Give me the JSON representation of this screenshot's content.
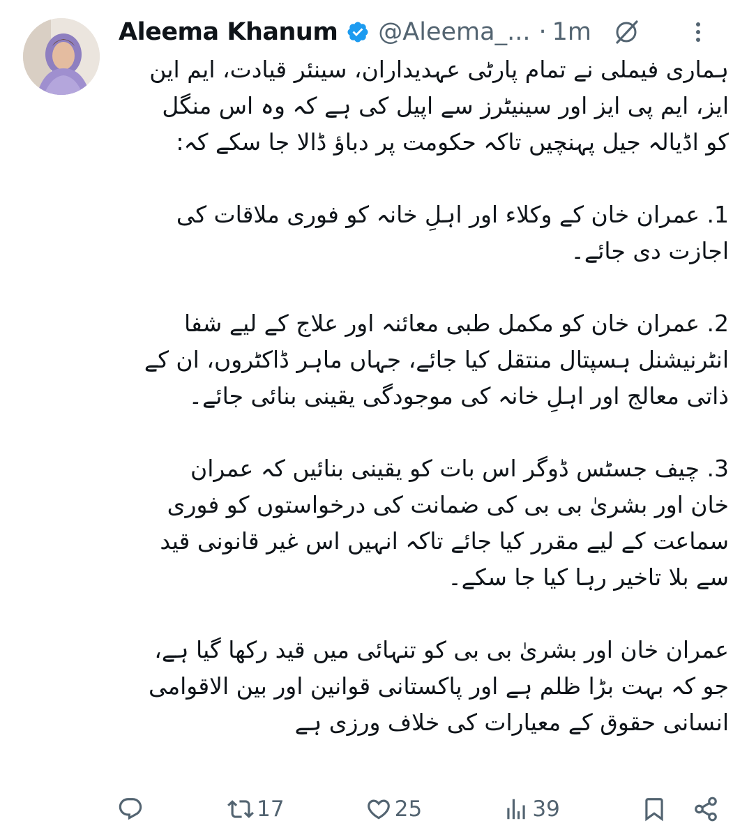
{
  "tweet": {
    "author": {
      "display_name": "Aleema Khanum",
      "handle": "@Aleema_...",
      "verified": true,
      "avatar": "avatar-photo"
    },
    "separator": "·",
    "time": "1m",
    "body": {
      "intro": [
        "ہماری فیملی نے تمام پارٹی عہدیداران، سینئر قیادت، ایم این",
        "ایز، ایم پی ایز اور سینیٹرز سے اپیل کی ہے کہ وہ اس منگل",
        "کو اڈیالہ جیل پہنچیں تاکہ حکومت پر دباؤ ڈالا جا سکے کہ:"
      ],
      "point1": [
        "1. عمران خان کے وکلاء اور اہلِ خانہ کو فوری ملاقات کی",
        "اجازت دی جائے۔"
      ],
      "point2": [
        "2. عمران خان کو مکمل طبی معائنہ اور علاج کے لیے شفا",
        "انٹرنیشنل ہسپتال منتقل کیا جائے، جہاں ماہر ڈاکٹروں، ان کے",
        "ذاتی معالج اور اہلِ خانہ کی موجودگی یقینی بنائی جائے۔"
      ],
      "point3": [
        "3. چیف جسٹس ڈوگر اس بات کو یقینی بنائیں کہ عمران",
        "خان اور بشریٰ بی بی کی ضمانت کی درخواستوں کو فوری",
        "سماعت کے لیے مقرر کیا جائے تاکہ انہیں اس غیر قانونی قید",
        "سے بلا تاخیر رہا کیا جا سکے۔"
      ],
      "closing": [
        "عمران خان اور بشریٰ بی بی کو تنہائی میں قید رکھا گیا ہے،",
        "جو کہ بہت بڑا ظلم ہے اور پاکستانی قوانین اور بین الاقوامی",
        "انسانی حقوق کے معیارات کی خلاف ورزی ہے"
      ]
    },
    "actions": {
      "reply_count": "",
      "retweet_count": "17",
      "like_count": "25",
      "views_count": "39"
    },
    "icons": [
      "verified-badge-icon",
      "grok-icon",
      "more-icon",
      "reply-icon",
      "retweet-icon",
      "like-icon",
      "views-icon",
      "bookmark-icon",
      "share-icon"
    ],
    "colors": {
      "text": "#0f1419",
      "secondary": "#536471",
      "verified": "#1d9bf0"
    }
  }
}
